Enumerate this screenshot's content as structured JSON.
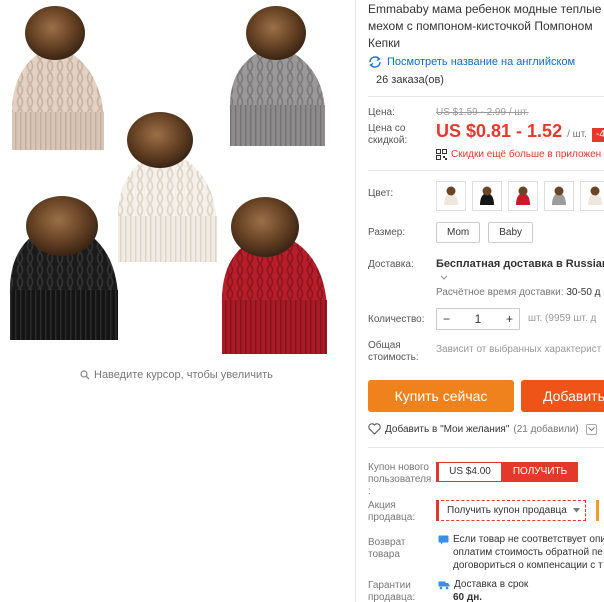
{
  "product": {
    "title_lines": [
      "Emmababy мама ребенок модные теплые",
      "мехом с помпоном-кисточкой Помпоном",
      "Кепки"
    ],
    "translate_link": "Посмотреть название на английском",
    "orders": "26 заказа(ов)"
  },
  "gallery": {
    "zoom_hint": "Наведите курсор, чтобы увеличить",
    "hats": [
      "beige",
      "gray",
      "white",
      "black",
      "red"
    ]
  },
  "pricing": {
    "price_label": "Цена:",
    "old_price": "US $1.59 - 2.99 / шт.",
    "discount_label_l1": "Цена со",
    "discount_label_l2": "скидкой:",
    "current_price": "US $0.81 - 1.52",
    "unit": "/ шт.",
    "discount_badge": "-4",
    "app_promo": "Скидки ещё больше в приложен"
  },
  "options": {
    "color_label": "Цвет:",
    "colors": [
      "#efe7df",
      "#151515",
      "#c51c2a",
      "#9c9c9c",
      "#efe7df"
    ],
    "size_label": "Размер:",
    "sizes": [
      "Mom",
      "Baby"
    ]
  },
  "shipping": {
    "label": "Доставка:",
    "line1": "Бесплатная доставка в Russian Fe",
    "line2_label": "Расчётное время доставки:",
    "line2_value": "30-50 д"
  },
  "quantity": {
    "label": "Количество:",
    "value": "1",
    "minus": "−",
    "plus": "+",
    "available": "шт. (9959 шт. д"
  },
  "total": {
    "label_l1": "Общая",
    "label_l2": "стоимость:",
    "value": "Зависит от выбранных характерист"
  },
  "actions": {
    "buy_now": "Купить сейчас",
    "add_cart": "Добавить",
    "wishlist": "Добавить в \"Мои желания\"",
    "wishlist_count": "(21 добавили)"
  },
  "coupon": {
    "label_l1": "Купон нового",
    "label_l2": "пользователя",
    "label_l3": ":",
    "amount": "US $4.00",
    "get": "ПОЛУЧИТЬ"
  },
  "promo": {
    "label_l1": "Акция",
    "label_l2": "продавца:",
    "text": "Получить купон продавца"
  },
  "returns": {
    "label_l1": "Возврат",
    "label_l2": "товара",
    "line1": "Если товар не соответствует опи",
    "line2": "оплатим стоимость обратной пе",
    "line3": "договориться о компенсации с т"
  },
  "guarantee": {
    "label_l1": "Гарантии",
    "label_l2": "продавца:",
    "line1": "Доставка в срок",
    "line2": "60 дн."
  },
  "colors": {
    "accent": "#e5382d",
    "orange": "#f0821e",
    "link": "#0a6ad8"
  }
}
